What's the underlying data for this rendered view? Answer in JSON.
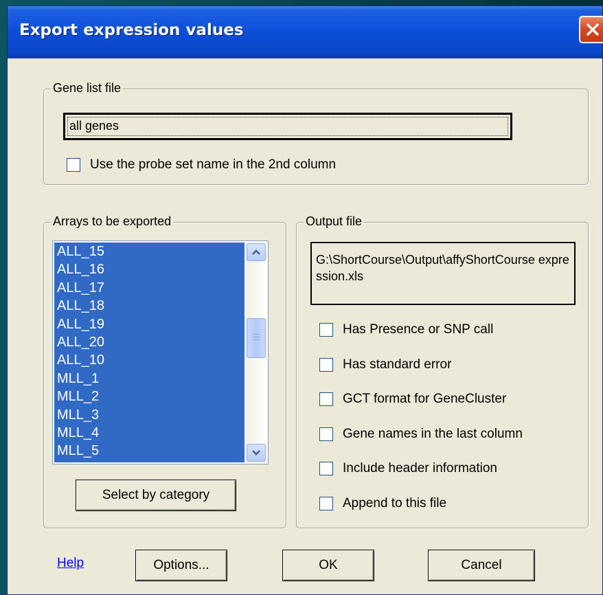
{
  "dialog": {
    "title": "Export expression values",
    "gene_list": {
      "legend": "Gene list file",
      "value": "all genes",
      "probe_checkbox": {
        "label": "Use the probe set name in the 2nd column",
        "checked": false
      }
    },
    "arrays": {
      "legend": "Arrays to be exported",
      "items": [
        "ALL_15",
        "ALL_16",
        "ALL_17",
        "ALL_18",
        "ALL_19",
        "ALL_20",
        "ALL_10",
        "MLL_1",
        "MLL_2",
        "MLL_3",
        "MLL_4",
        "MLL_5"
      ],
      "select_button": "Select by category"
    },
    "output": {
      "legend": "Output file",
      "path": "G:\\ShortCourse\\Output\\affyShortCourse expression.xls",
      "options": [
        {
          "label": "Has Presence or SNP call",
          "checked": false
        },
        {
          "label": "Has standard error",
          "checked": false
        },
        {
          "label": "GCT format for GeneCluster",
          "checked": false
        },
        {
          "label": "Gene names in the last column",
          "checked": false
        },
        {
          "label": "Include header information",
          "checked": false
        },
        {
          "label": "Append to this file",
          "checked": false
        }
      ]
    },
    "buttons": {
      "help": "Help",
      "options": "Options...",
      "ok": "OK",
      "cancel": "Cancel"
    }
  },
  "colors": {
    "titlebar": "#0a46c8",
    "selection": "#316ac5",
    "dialog_bg": "#ece9d8",
    "close": "#d84a24"
  },
  "icons": [
    "close-icon",
    "scroll-up-icon",
    "scroll-down-icon"
  ]
}
